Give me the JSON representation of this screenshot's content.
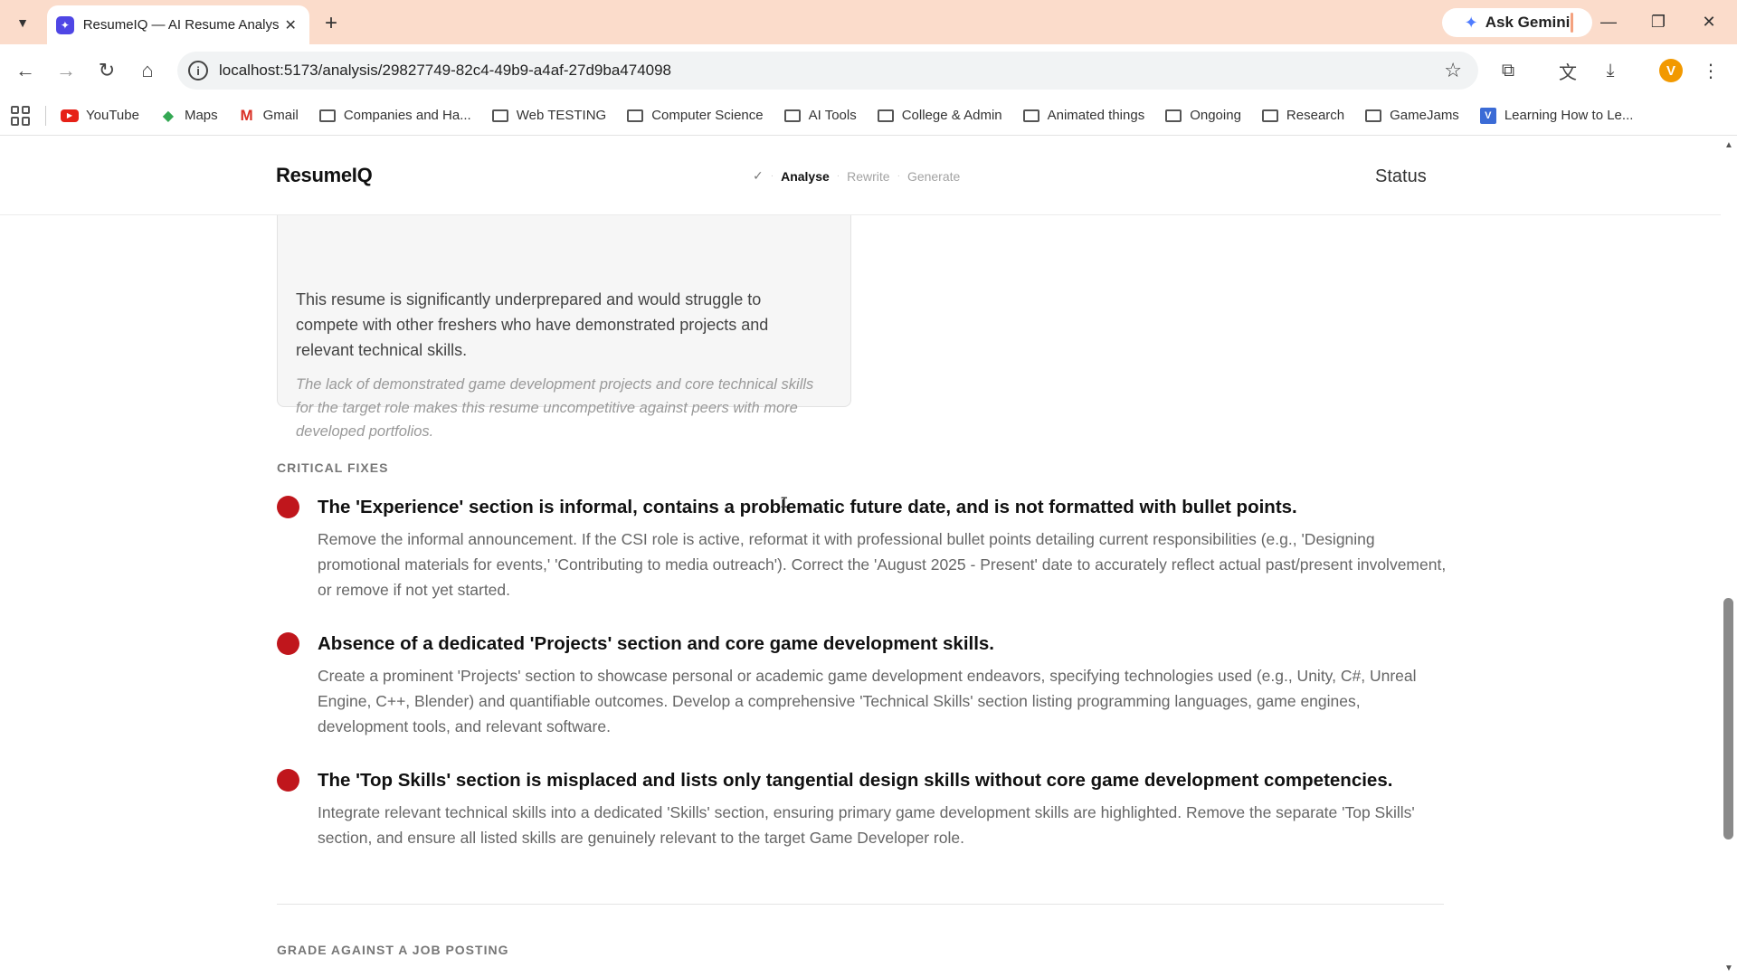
{
  "browser": {
    "tab_title": "ResumeIQ — AI Resume Analys",
    "tab_favicon": "✦",
    "ask_gemini": "Ask Gemini",
    "url": "localhost:5173/analysis/29827749-82c4-49b9-a4af-27d9ba474098",
    "profile_initial": "V",
    "bookmarks": [
      {
        "label": "YouTube",
        "icon": "youtube-icon"
      },
      {
        "label": "Maps",
        "icon": "maps-icon"
      },
      {
        "label": "Gmail",
        "icon": "gmail-icon"
      },
      {
        "label": "Companies and Ha...",
        "icon": "folder-icon"
      },
      {
        "label": "Web TESTING",
        "icon": "folder-icon"
      },
      {
        "label": "Computer Science",
        "icon": "folder-icon"
      },
      {
        "label": "AI Tools",
        "icon": "folder-icon"
      },
      {
        "label": "College & Admin",
        "icon": "folder-icon"
      },
      {
        "label": "Animated things",
        "icon": "folder-icon"
      },
      {
        "label": "Ongoing",
        "icon": "folder-icon"
      },
      {
        "label": "Research",
        "icon": "folder-icon"
      },
      {
        "label": "GameJams",
        "icon": "folder-icon"
      },
      {
        "label": "Learning How to Le...",
        "icon": "learning-icon"
      }
    ]
  },
  "app": {
    "brand": "ResumeIQ",
    "steps": {
      "check": "✓",
      "analyse": "Analyse",
      "rewrite": "Rewrite",
      "generate": "Generate"
    },
    "status": "Status"
  },
  "verdict": {
    "summary": "This resume is significantly underprepared and would struggle to compete with other freshers who have demonstrated projects and relevant technical skills.",
    "note": "The lack of demonstrated game development projects and core technical skills for the target role makes this resume uncompetitive against peers with more developed portfolios."
  },
  "critical_fixes": {
    "label": "CRITICAL FIXES",
    "items": [
      {
        "title": "The 'Experience' section is informal, contains a problematic future date, and is not formatted with bullet points.",
        "detail": "Remove the informal announcement. If the CSI role is active, reformat it with professional bullet points detailing current responsibilities (e.g., 'Designing promotional materials for events,' 'Contributing to media outreach'). Correct the 'August 2025 - Present' date to accurately reflect actual past/present involvement, or remove if not yet started."
      },
      {
        "title": "Absence of a dedicated 'Projects' section and core game development skills.",
        "detail": "Create a prominent 'Projects' section to showcase personal or academic game development endeavors, specifying technologies used (e.g., Unity, C#, Unreal Engine, C++, Blender) and quantifiable outcomes. Develop a comprehensive 'Technical Skills' section listing programming languages, game engines, development tools, and relevant software."
      },
      {
        "title": "The 'Top Skills' section is misplaced and lists only tangential design skills without core game development competencies.",
        "detail": "Integrate relevant technical skills into a dedicated 'Skills' section, ensuring primary game development skills are highlighted. Remove the separate 'Top Skills' section, and ensure all listed skills are genuinely relevant to the target Game Developer role."
      }
    ]
  },
  "job_posting": {
    "label": "GRADE AGAINST A JOB POSTING"
  },
  "colors": {
    "tabbar": "#fbdccb",
    "critical": "#c0161c",
    "brand_text": "#111111"
  }
}
